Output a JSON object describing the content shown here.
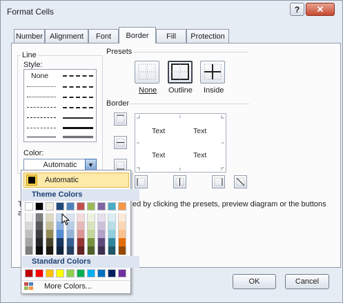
{
  "window": {
    "title": "Format Cells",
    "help_label": "?",
    "close_label": "✕"
  },
  "tabs": [
    "Number",
    "Alignment",
    "Font",
    "Border",
    "Fill",
    "Protection"
  ],
  "active_tab": "Border",
  "line": {
    "group_label": "Line",
    "style_label": "Style:",
    "none_label": "None",
    "color_label": "Color:",
    "color_value": "Automatic"
  },
  "presets": {
    "group_label": "Presets",
    "items": [
      {
        "label": "None"
      },
      {
        "label": "Outline"
      },
      {
        "label": "Inside"
      }
    ]
  },
  "border": {
    "group_label": "Border",
    "preview_texts": [
      "Text",
      "Text",
      "Text",
      "Text"
    ],
    "help_text_part1": "Th",
    "help_text_part2": "ab",
    "help_text_tail": "ed by clicking the presets, preview diagram or the buttons"
  },
  "color_popup": {
    "automatic_label": "Automatic",
    "theme_header": "Theme Colors",
    "standard_header": "Standard Colors",
    "more_colors_label": "More Colors...",
    "theme_top_row": [
      "#ffffff",
      "#000000",
      "#eeece1",
      "#1f497d",
      "#4f81bd",
      "#c0504d",
      "#9bbb59",
      "#8064a2",
      "#4bacc6",
      "#f79646"
    ],
    "theme_shades": [
      [
        "#f2f2f2",
        "#7f7f7f",
        "#ddd9c3",
        "#c6d9f0",
        "#dbe5f1",
        "#f2dcdb",
        "#ebf1dd",
        "#e5e0ec",
        "#dbeef3",
        "#fdeada"
      ],
      [
        "#d8d8d8",
        "#595959",
        "#c4bd97",
        "#8db3e2",
        "#b8cce4",
        "#e5b9b7",
        "#d7e3bc",
        "#ccc1d9",
        "#b7dde8",
        "#fbd5b5"
      ],
      [
        "#bfbfbf",
        "#3f3f3f",
        "#938953",
        "#548dd4",
        "#95b3d7",
        "#d99694",
        "#c3d69b",
        "#b2a2c7",
        "#92cddc",
        "#fac08f"
      ],
      [
        "#a5a5a5",
        "#262626",
        "#494429",
        "#17365d",
        "#366092",
        "#953734",
        "#76923c",
        "#5f497a",
        "#31859b",
        "#e36c09"
      ],
      [
        "#7f7f7f",
        "#0c0c0c",
        "#1d1b10",
        "#0f243e",
        "#244061",
        "#632423",
        "#4f6128",
        "#3f3151",
        "#205867",
        "#974806"
      ]
    ],
    "standard_colors": [
      "#c00000",
      "#ff0000",
      "#ffc000",
      "#ffff00",
      "#92d050",
      "#00b050",
      "#00b0f0",
      "#0070c0",
      "#002060",
      "#7030a0"
    ]
  },
  "buttons": {
    "ok": "OK",
    "cancel": "Cancel"
  }
}
